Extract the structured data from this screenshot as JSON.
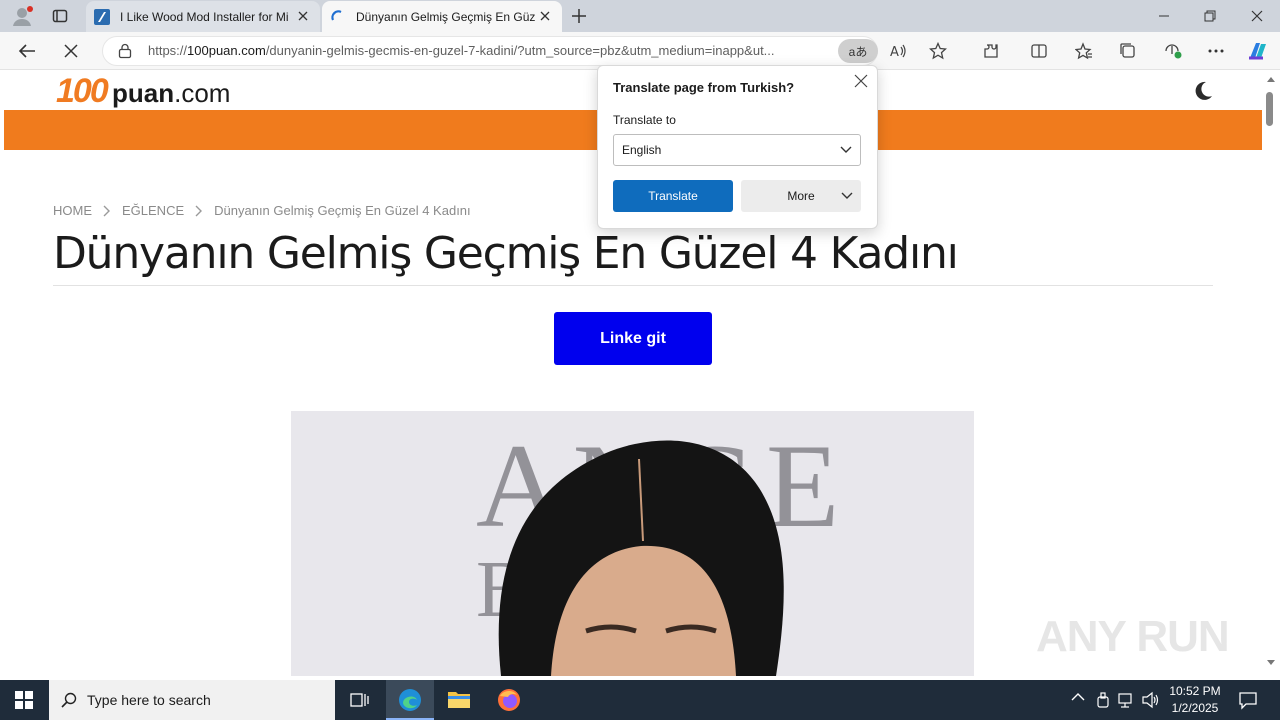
{
  "browser": {
    "tabs": [
      {
        "title": "I Like Wood Mod Installer for Mi",
        "active": false
      },
      {
        "title": "Dünyanın Gelmiş Geçmiş En Güz",
        "active": true
      }
    ],
    "url_prefix": "https://",
    "url_host": "100puan.com",
    "url_path": "/dunyanin-gelmis-gecmis-en-guzel-7-kadini/?utm_source=pbz&utm_medium=inapp&ut...",
    "translate_chip": "aあ"
  },
  "site": {
    "logo_number": "100",
    "logo_name": "puan",
    "logo_tld": ".com",
    "accent": "#f07b1d"
  },
  "article": {
    "breadcrumb": [
      "HOME",
      "EĞLENCE",
      "Dünyanın Gelmiş Geçmiş En Güzel 4 Kadını"
    ],
    "title": "Dünyanın Gelmiş Geçmiş En Güzel 4 Kadını",
    "cta_label": "Linke git",
    "cta_color": "#0000ee"
  },
  "translate_popup": {
    "title": "Translate page from Turkish?",
    "label": "Translate to",
    "selected_language": "English",
    "translate_button": "Translate",
    "more_button": "More"
  },
  "taskbar": {
    "search_placeholder": "Type here to search",
    "time": "10:52 PM",
    "date": "1/2/2025"
  },
  "watermark": "ANY RUN"
}
